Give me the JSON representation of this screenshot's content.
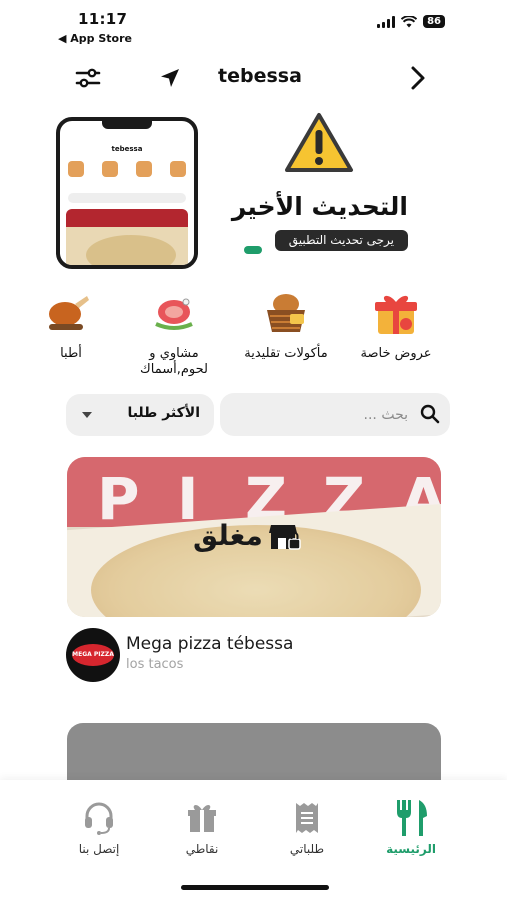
{
  "status_bar": {
    "time": "11:17",
    "back_app": "◀ App Store",
    "battery": "86"
  },
  "header": {
    "city": "tebessa"
  },
  "banner": {
    "title": "التحديث الأخير",
    "subtitle": "يرجى تحديث التطبيق",
    "mini_city": "tebessa"
  },
  "categories": [
    {
      "label": "عروض خاصة",
      "icon": "gift-icon"
    },
    {
      "label": "مأكولات تقليدية",
      "icon": "bread-basket-icon"
    },
    {
      "label": "مشاوي و لحوم,أسماك",
      "icon": "meat-grill-icon"
    },
    {
      "label": "أطبا",
      "icon": "roast-chicken-icon"
    }
  ],
  "search": {
    "placeholder": "بحث ..."
  },
  "sort": {
    "label": "الأكثر طلبا"
  },
  "restaurants": [
    {
      "name": "Mega pizza tébessa",
      "subtitle": "los tacos",
      "status": "مغلق",
      "logo_text": "MEGA PIZZA"
    }
  ],
  "nav": {
    "home": "الرئيسية",
    "orders": "طلباتي",
    "points": "نقاطي",
    "contact": "إتصل بنا"
  },
  "colors": {
    "accent": "#1f9d6b",
    "text": "#111111",
    "muted": "#a3a3a3"
  }
}
